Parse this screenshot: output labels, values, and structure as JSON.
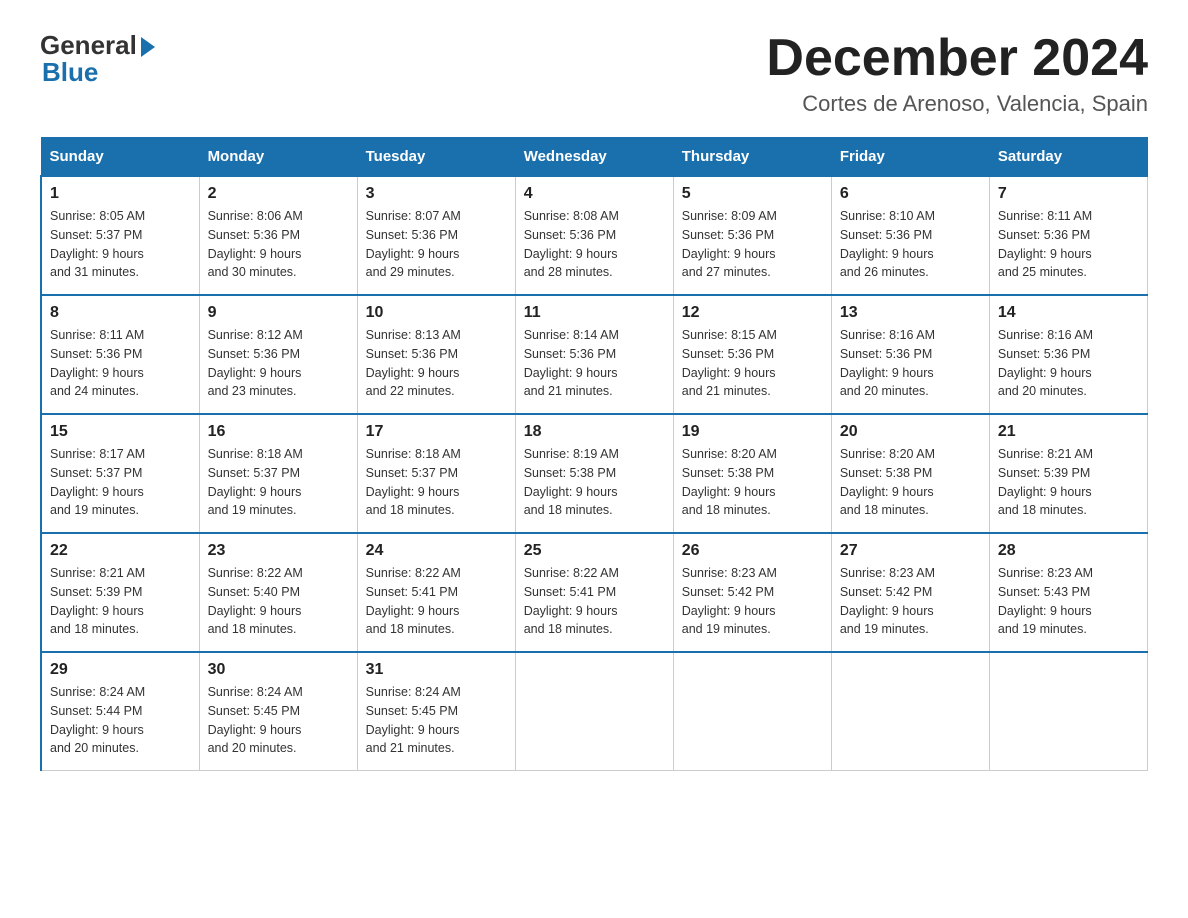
{
  "logo": {
    "general": "General",
    "blue": "Blue"
  },
  "title": "December 2024",
  "location": "Cortes de Arenoso, Valencia, Spain",
  "days_of_week": [
    "Sunday",
    "Monday",
    "Tuesday",
    "Wednesday",
    "Thursday",
    "Friday",
    "Saturday"
  ],
  "weeks": [
    [
      {
        "day": "1",
        "sunrise": "8:05 AM",
        "sunset": "5:37 PM",
        "daylight": "9 hours and 31 minutes."
      },
      {
        "day": "2",
        "sunrise": "8:06 AM",
        "sunset": "5:36 PM",
        "daylight": "9 hours and 30 minutes."
      },
      {
        "day": "3",
        "sunrise": "8:07 AM",
        "sunset": "5:36 PM",
        "daylight": "9 hours and 29 minutes."
      },
      {
        "day": "4",
        "sunrise": "8:08 AM",
        "sunset": "5:36 PM",
        "daylight": "9 hours and 28 minutes."
      },
      {
        "day": "5",
        "sunrise": "8:09 AM",
        "sunset": "5:36 PM",
        "daylight": "9 hours and 27 minutes."
      },
      {
        "day": "6",
        "sunrise": "8:10 AM",
        "sunset": "5:36 PM",
        "daylight": "9 hours and 26 minutes."
      },
      {
        "day": "7",
        "sunrise": "8:11 AM",
        "sunset": "5:36 PM",
        "daylight": "9 hours and 25 minutes."
      }
    ],
    [
      {
        "day": "8",
        "sunrise": "8:11 AM",
        "sunset": "5:36 PM",
        "daylight": "9 hours and 24 minutes."
      },
      {
        "day": "9",
        "sunrise": "8:12 AM",
        "sunset": "5:36 PM",
        "daylight": "9 hours and 23 minutes."
      },
      {
        "day": "10",
        "sunrise": "8:13 AM",
        "sunset": "5:36 PM",
        "daylight": "9 hours and 22 minutes."
      },
      {
        "day": "11",
        "sunrise": "8:14 AM",
        "sunset": "5:36 PM",
        "daylight": "9 hours and 21 minutes."
      },
      {
        "day": "12",
        "sunrise": "8:15 AM",
        "sunset": "5:36 PM",
        "daylight": "9 hours and 21 minutes."
      },
      {
        "day": "13",
        "sunrise": "8:16 AM",
        "sunset": "5:36 PM",
        "daylight": "9 hours and 20 minutes."
      },
      {
        "day": "14",
        "sunrise": "8:16 AM",
        "sunset": "5:36 PM",
        "daylight": "9 hours and 20 minutes."
      }
    ],
    [
      {
        "day": "15",
        "sunrise": "8:17 AM",
        "sunset": "5:37 PM",
        "daylight": "9 hours and 19 minutes."
      },
      {
        "day": "16",
        "sunrise": "8:18 AM",
        "sunset": "5:37 PM",
        "daylight": "9 hours and 19 minutes."
      },
      {
        "day": "17",
        "sunrise": "8:18 AM",
        "sunset": "5:37 PM",
        "daylight": "9 hours and 18 minutes."
      },
      {
        "day": "18",
        "sunrise": "8:19 AM",
        "sunset": "5:38 PM",
        "daylight": "9 hours and 18 minutes."
      },
      {
        "day": "19",
        "sunrise": "8:20 AM",
        "sunset": "5:38 PM",
        "daylight": "9 hours and 18 minutes."
      },
      {
        "day": "20",
        "sunrise": "8:20 AM",
        "sunset": "5:38 PM",
        "daylight": "9 hours and 18 minutes."
      },
      {
        "day": "21",
        "sunrise": "8:21 AM",
        "sunset": "5:39 PM",
        "daylight": "9 hours and 18 minutes."
      }
    ],
    [
      {
        "day": "22",
        "sunrise": "8:21 AM",
        "sunset": "5:39 PM",
        "daylight": "9 hours and 18 minutes."
      },
      {
        "day": "23",
        "sunrise": "8:22 AM",
        "sunset": "5:40 PM",
        "daylight": "9 hours and 18 minutes."
      },
      {
        "day": "24",
        "sunrise": "8:22 AM",
        "sunset": "5:41 PM",
        "daylight": "9 hours and 18 minutes."
      },
      {
        "day": "25",
        "sunrise": "8:22 AM",
        "sunset": "5:41 PM",
        "daylight": "9 hours and 18 minutes."
      },
      {
        "day": "26",
        "sunrise": "8:23 AM",
        "sunset": "5:42 PM",
        "daylight": "9 hours and 19 minutes."
      },
      {
        "day": "27",
        "sunrise": "8:23 AM",
        "sunset": "5:42 PM",
        "daylight": "9 hours and 19 minutes."
      },
      {
        "day": "28",
        "sunrise": "8:23 AM",
        "sunset": "5:43 PM",
        "daylight": "9 hours and 19 minutes."
      }
    ],
    [
      {
        "day": "29",
        "sunrise": "8:24 AM",
        "sunset": "5:44 PM",
        "daylight": "9 hours and 20 minutes."
      },
      {
        "day": "30",
        "sunrise": "8:24 AM",
        "sunset": "5:45 PM",
        "daylight": "9 hours and 20 minutes."
      },
      {
        "day": "31",
        "sunrise": "8:24 AM",
        "sunset": "5:45 PM",
        "daylight": "9 hours and 21 minutes."
      },
      null,
      null,
      null,
      null
    ]
  ],
  "labels": {
    "sunrise": "Sunrise:",
    "sunset": "Sunset:",
    "daylight": "Daylight:"
  }
}
